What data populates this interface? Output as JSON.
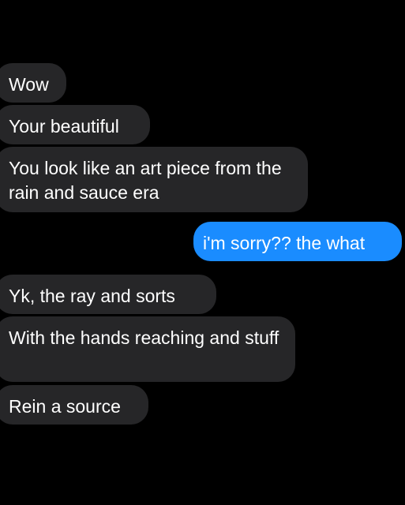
{
  "conversation": {
    "messages": [
      {
        "sender": "them",
        "text": "Wow"
      },
      {
        "sender": "them",
        "text": "Your beautiful"
      },
      {
        "sender": "them",
        "text": "You look like an art piece from the rain and sauce era"
      },
      {
        "sender": "me",
        "text": "i'm sorry?? the what"
      },
      {
        "sender": "them",
        "text": "Yk, the ray and sorts"
      },
      {
        "sender": "them",
        "text": "With the hands reaching and stuff"
      },
      {
        "sender": "them",
        "text": "Rein a source"
      }
    ]
  },
  "colors": {
    "background": "#000000",
    "incoming_bubble": "#262628",
    "outgoing_bubble": "#1a8cff",
    "text": "#ffffff"
  }
}
